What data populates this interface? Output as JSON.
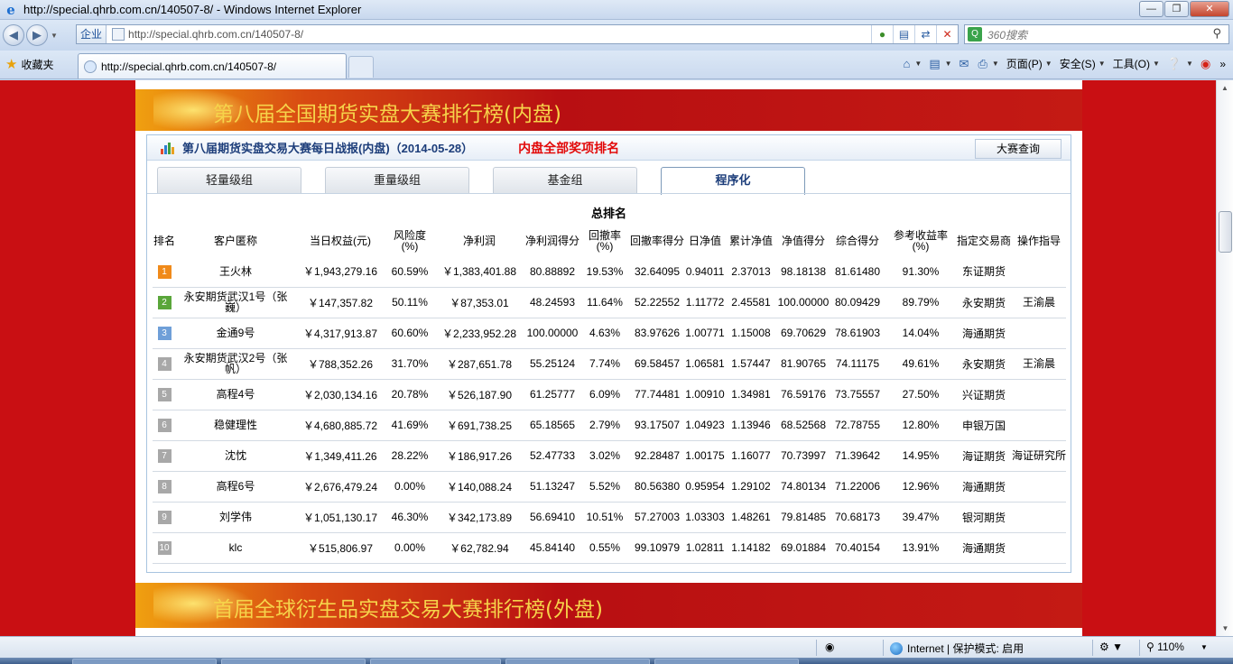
{
  "window": {
    "title": "http://special.qhrb.com.cn/140507-8/ - Windows Internet Explorer"
  },
  "nav": {
    "zone_label": "企业",
    "url": "http://special.qhrb.com.cn/140507-8/",
    "search_placeholder": "360搜索"
  },
  "tabs_bar": {
    "favorites_label": "收藏夹",
    "tab_title": "http://special.qhrb.com.cn/140507-8/",
    "commands": [
      {
        "label": "页面(P)"
      },
      {
        "label": "安全(S)"
      },
      {
        "label": "工具(O)"
      }
    ]
  },
  "page": {
    "banner_title": "第八届全国期货实盘大赛排行榜(内盘)",
    "box_title": "第八届期货实盘交易大赛每日战报(内盘)（2014-05-28）",
    "box_subtitle": "内盘全部奖项排名",
    "query_button": "大赛查询",
    "group_tabs": [
      {
        "label": "轻量级组"
      },
      {
        "label": "重量级组"
      },
      {
        "label": "基金组"
      },
      {
        "label": "程序化"
      }
    ],
    "ranking_title": "总排名",
    "headers": [
      "排名",
      "客户匿称",
      "当日权益(元)",
      "风险度(%)",
      "净利润",
      "净利润得分",
      "回撤率(%)",
      "回撤率得分",
      "日净值",
      "累计净值",
      "净值得分",
      "综合得分",
      "参考收益率(%)",
      "指定交易商",
      "操作指导"
    ],
    "rows": [
      {
        "rank": "1",
        "name": "王火林",
        "equity": "￥1,943,279.16",
        "risk": "60.59%",
        "profit": "￥1,383,401.88",
        "profit_score": "80.88892",
        "drawdown": "19.53%",
        "drawdown_score": "32.64095",
        "nav": "0.94011",
        "cum_nav": "2.37013",
        "nav_score": "98.18138",
        "total": "81.61480",
        "ret": "91.30%",
        "broker": "东证期货",
        "guide": ""
      },
      {
        "rank": "2",
        "name": "永安期货武汉1号（张巍）",
        "equity": "￥147,357.82",
        "risk": "50.11%",
        "profit": "￥87,353.01",
        "profit_score": "48.24593",
        "drawdown": "11.64%",
        "drawdown_score": "52.22552",
        "nav": "1.11772",
        "cum_nav": "2.45581",
        "nav_score": "100.00000",
        "total": "80.09429",
        "ret": "89.79%",
        "broker": "永安期货",
        "guide": "王渝晨"
      },
      {
        "rank": "3",
        "name": "金通9号",
        "equity": "￥4,317,913.87",
        "risk": "60.60%",
        "profit": "￥2,233,952.28",
        "profit_score": "100.00000",
        "drawdown": "4.63%",
        "drawdown_score": "83.97626",
        "nav": "1.00771",
        "cum_nav": "1.15008",
        "nav_score": "69.70629",
        "total": "78.61903",
        "ret": "14.04%",
        "broker": "海通期货",
        "guide": ""
      },
      {
        "rank": "4",
        "name": "永安期货武汉2号（张帆）",
        "equity": "￥788,352.26",
        "risk": "31.70%",
        "profit": "￥287,651.78",
        "profit_score": "55.25124",
        "drawdown": "7.74%",
        "drawdown_score": "69.58457",
        "nav": "1.06581",
        "cum_nav": "1.57447",
        "nav_score": "81.90765",
        "total": "74.11175",
        "ret": "49.61%",
        "broker": "永安期货",
        "guide": "王渝晨"
      },
      {
        "rank": "5",
        "name": "高程4号",
        "equity": "￥2,030,134.16",
        "risk": "20.78%",
        "profit": "￥526,187.90",
        "profit_score": "61.25777",
        "drawdown": "6.09%",
        "drawdown_score": "77.74481",
        "nav": "1.00910",
        "cum_nav": "1.34981",
        "nav_score": "76.59176",
        "total": "73.75557",
        "ret": "27.50%",
        "broker": "兴证期货",
        "guide": ""
      },
      {
        "rank": "6",
        "name": "稳健理性",
        "equity": "￥4,680,885.72",
        "risk": "41.69%",
        "profit": "￥691,738.25",
        "profit_score": "65.18565",
        "drawdown": "2.79%",
        "drawdown_score": "93.17507",
        "nav": "1.04923",
        "cum_nav": "1.13946",
        "nav_score": "68.52568",
        "total": "72.78755",
        "ret": "12.80%",
        "broker": "申银万国",
        "guide": ""
      },
      {
        "rank": "7",
        "name": "沈忱",
        "equity": "￥1,349,411.26",
        "risk": "28.22%",
        "profit": "￥186,917.26",
        "profit_score": "52.47733",
        "drawdown": "3.02%",
        "drawdown_score": "92.28487",
        "nav": "1.00175",
        "cum_nav": "1.16077",
        "nav_score": "70.73997",
        "total": "71.39642",
        "ret": "14.95%",
        "broker": "海证期货",
        "guide": "海证研究所"
      },
      {
        "rank": "8",
        "name": "高程6号",
        "equity": "￥2,676,479.24",
        "risk": "0.00%",
        "profit": "￥140,088.24",
        "profit_score": "51.13247",
        "drawdown": "5.52%",
        "drawdown_score": "80.56380",
        "nav": "0.95954",
        "cum_nav": "1.29102",
        "nav_score": "74.80134",
        "total": "71.22006",
        "ret": "12.96%",
        "broker": "海通期货",
        "guide": ""
      },
      {
        "rank": "9",
        "name": "刘学伟",
        "equity": "￥1,051,130.17",
        "risk": "46.30%",
        "profit": "￥342,173.89",
        "profit_score": "56.69410",
        "drawdown": "10.51%",
        "drawdown_score": "57.27003",
        "nav": "1.03303",
        "cum_nav": "1.48261",
        "nav_score": "79.81485",
        "total": "70.68173",
        "ret": "39.47%",
        "broker": "银河期货",
        "guide": ""
      },
      {
        "rank": "10",
        "name": "klc",
        "equity": "￥515,806.97",
        "risk": "0.00%",
        "profit": "￥62,782.94",
        "profit_score": "45.84140",
        "drawdown": "0.55%",
        "drawdown_score": "99.10979",
        "nav": "1.02811",
        "cum_nav": "1.14182",
        "nav_score": "69.01884",
        "total": "70.40154",
        "ret": "13.91%",
        "broker": "海通期货",
        "guide": ""
      }
    ],
    "banner2_title": "首届全球衍生品实盘交易大赛排行榜(外盘)"
  },
  "status": {
    "zone": "Internet | 保护模式: 启用",
    "zoom": "110%"
  },
  "colors": {
    "page_bg": "#c90f13",
    "rank_top3": [
      "#f08a1a",
      "#5aa63a",
      "#6f9fd8"
    ],
    "rank_other": "#a8a8a8",
    "subtitle_red": "#e20a0a"
  }
}
